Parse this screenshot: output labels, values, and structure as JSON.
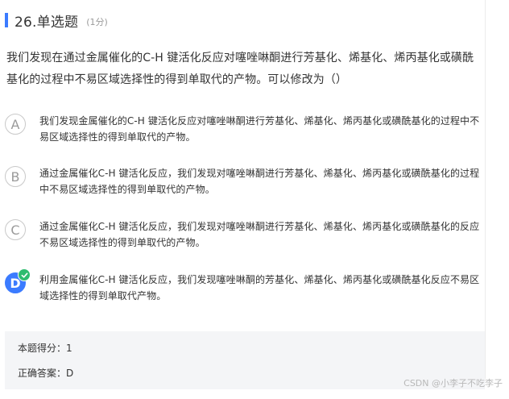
{
  "question": {
    "number_type": "26.单选题",
    "score": "(1分)",
    "stem": "我们发现在通过金属催化的C-H 键活化反应对噻唑啉酮进行芳基化、烯基化、烯丙基化或磺酰基化的过程中不易区域选择性的得到单取代的产物。可以修改为（）"
  },
  "options": [
    {
      "letter": "A",
      "text": "我们发现金属催化的C-H 键活化反应对噻唑啉酮进行芳基化、烯基化、烯丙基化或磺酰基化的过程中不易区域选择性的得到单取代的产物。",
      "correct": false
    },
    {
      "letter": "B",
      "text": "通过金属催化C-H 键活化反应，我们发现对噻唑啉酮进行芳基化、烯基化、烯丙基化或磺酰基化的过程中不易区域选择性的得到单取代的产物。",
      "correct": false
    },
    {
      "letter": "C",
      "text": "通过金属催化C-H 键活化反应，我们发现对噻唑啉酮进行芳基化、烯基化、烯丙基化或磺酰基化的反应不易区域选择性的得到单取代的产物。",
      "correct": false
    },
    {
      "letter": "D",
      "text": "利用金属催化C-H 键活化反应，我们发现噻唑啉酮的芳基化、烯基化、烯丙基化或磺酰基化反应不易区域选择性的得到单取代产物。",
      "correct": true
    }
  ],
  "result": {
    "score_line": "本题得分：1",
    "answer_line": "正确答案：D"
  },
  "watermark": "CSDN @小李子不吃李子",
  "colors": {
    "accent": "#3b7bff",
    "correct_badge": "#2ebc6f",
    "answer_bg": "#f4f5f7"
  }
}
